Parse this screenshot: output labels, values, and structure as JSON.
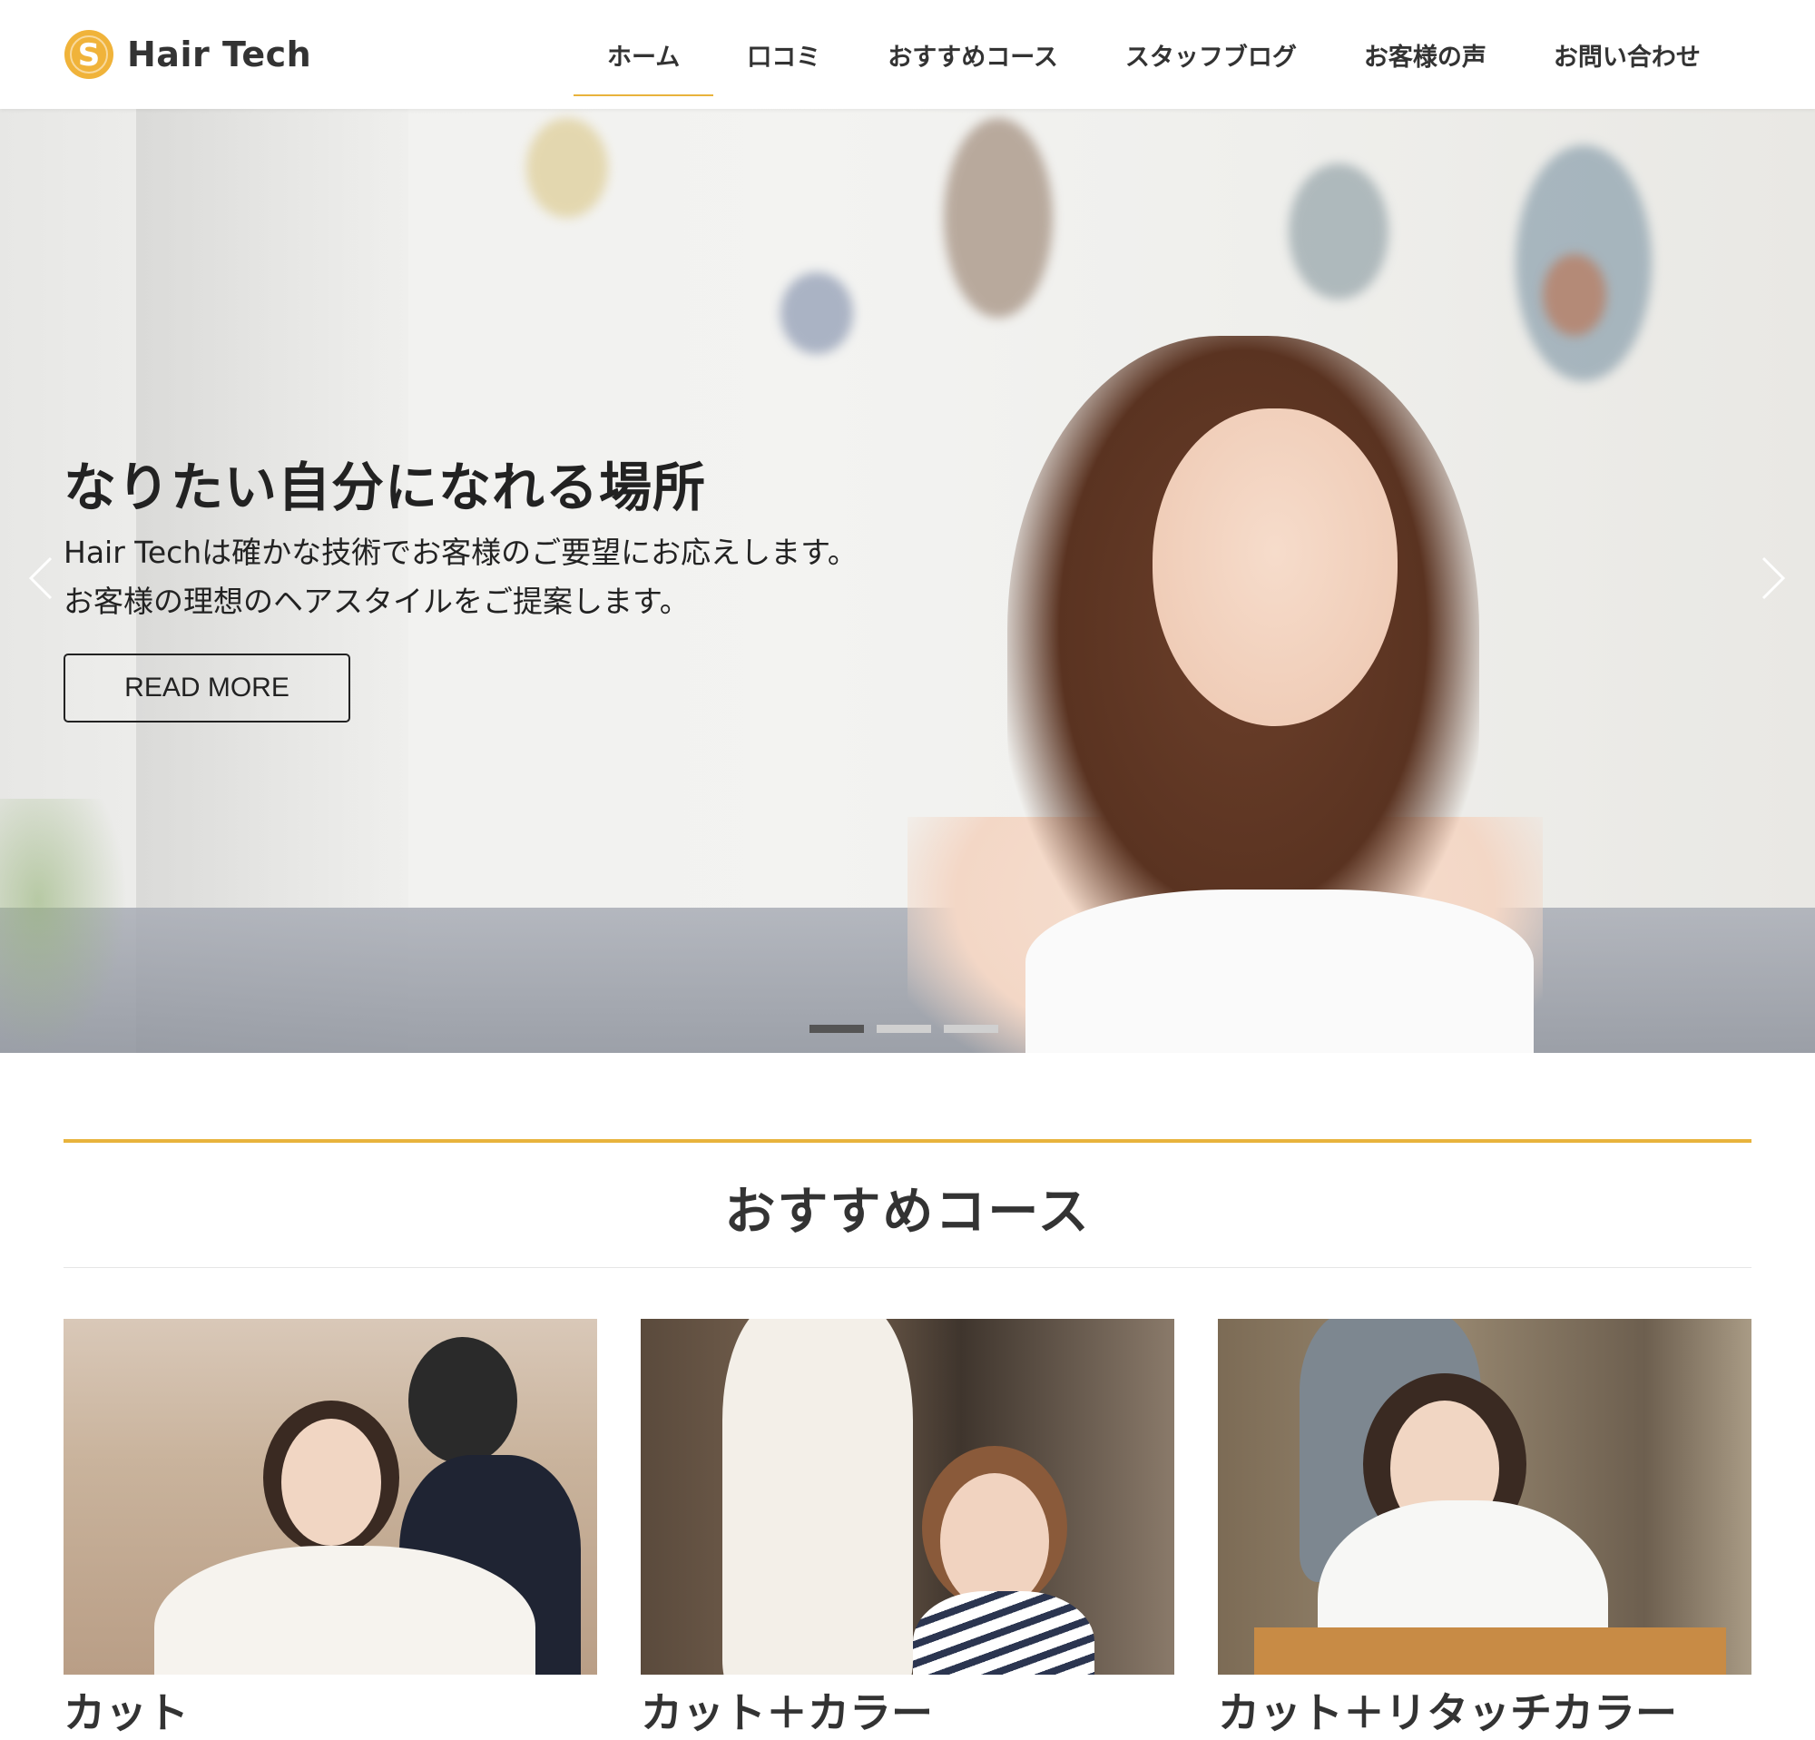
{
  "header": {
    "logo_text": "Hair Tech",
    "logo_icon": "s-coin-logo-icon",
    "accent_color": "#e8b33c",
    "nav": [
      {
        "label": "ホーム",
        "active": true
      },
      {
        "label": "口コミ",
        "active": false
      },
      {
        "label": "おすすめコース",
        "active": false
      },
      {
        "label": "スタッフブログ",
        "active": false
      },
      {
        "label": "お客様の声",
        "active": false
      },
      {
        "label": "お問い合わせ",
        "active": false
      }
    ]
  },
  "hero": {
    "title": "なりたい自分になれる場所",
    "text_line1": "Hair Techは確かな技術でお客様のご要望にお応えします。",
    "text_line2": "お客様の理想のヘアスタイルをご提案します。",
    "button_label": "READ MORE",
    "prev_icon": "chevron-left-icon",
    "next_icon": "chevron-right-icon",
    "slide_count": 3,
    "active_slide": 1
  },
  "courses": {
    "title": "おすすめコース",
    "items": [
      {
        "title": "カット"
      },
      {
        "title": "カット＋カラー"
      },
      {
        "title": "カット＋リタッチカラー"
      }
    ]
  }
}
